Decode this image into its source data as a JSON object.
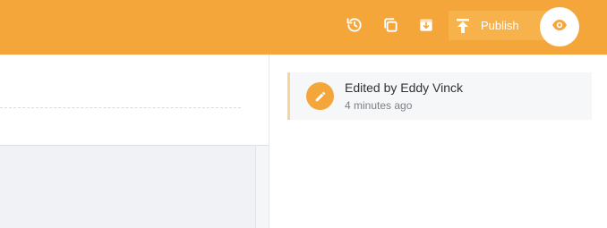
{
  "toolbar": {
    "icons": [
      "history-icon",
      "duplicate-icon",
      "archive-icon"
    ],
    "publish_label": "Publish",
    "accent_color": "#f4a63a"
  },
  "activity": {
    "items": [
      {
        "title": "Edited by Eddy Vinck",
        "time": "4 minutes ago",
        "icon": "pencil-icon"
      }
    ]
  }
}
